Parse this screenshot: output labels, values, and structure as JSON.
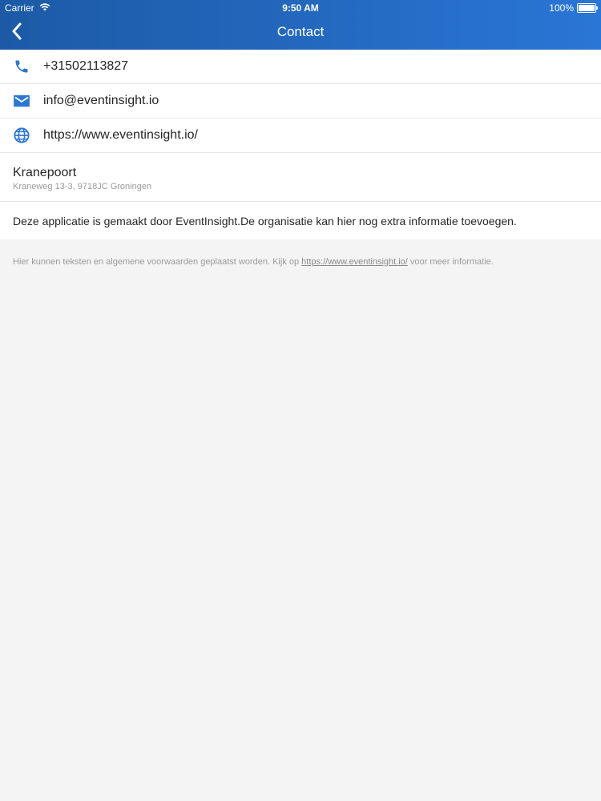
{
  "status_bar": {
    "carrier": "Carrier",
    "time": "9:50 AM",
    "battery": "100%"
  },
  "nav": {
    "title": "Contact"
  },
  "contact": {
    "phone": "+31502113827",
    "email": "info@eventinsight.io",
    "website": "https://www.eventinsight.io/"
  },
  "address": {
    "name": "Kranepoort",
    "line": "Kraneweg 13-3, 9718JC Groningen"
  },
  "description": "Deze applicatie is gemaakt door EventInsight.De organisatie kan hier nog extra informatie toevoegen.",
  "footer": {
    "prefix": "Hier kunnen teksten en algemene voorwaarden geplaatst worden. Kijk op ",
    "link": "https://www.eventinsight.io/",
    "suffix": " voor meer informatie."
  },
  "colors": {
    "header_start": "#1c5aa6",
    "header_end": "#2a76d6",
    "icon_blue": "#2d78d0"
  },
  "icons": {
    "back": "chevron-left-icon",
    "phone": "phone-icon",
    "email": "email-icon",
    "website": "globe-icon",
    "wifi": "wifi-icon",
    "battery": "battery-icon"
  }
}
